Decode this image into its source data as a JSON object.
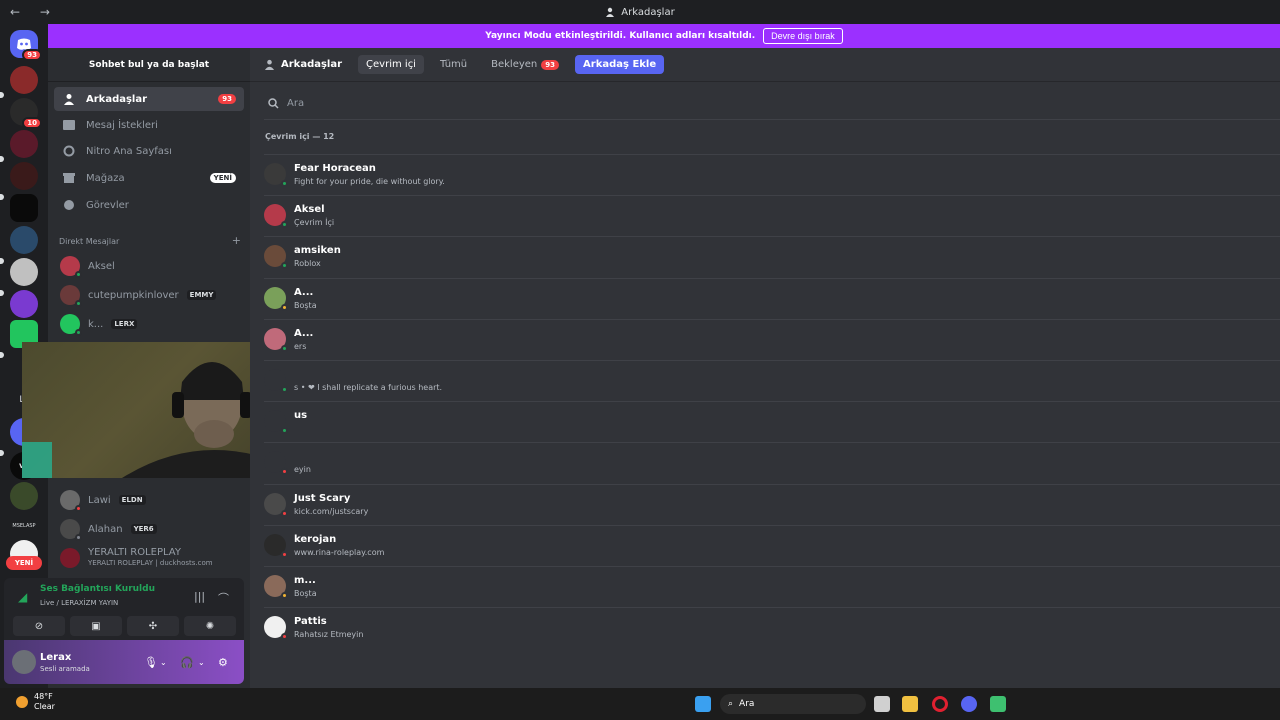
{
  "window": {
    "title": "Arkadaşlar",
    "nav_arrows": "← →"
  },
  "banner": {
    "text": "Yayıncı Modu etkinleştirildi. Kullanıcı adları kısaltıldı.",
    "button": "Devre dışı bırak"
  },
  "servers": {
    "home_badge": "93",
    "badge_2": "10",
    "new_label": "YENİ",
    "text_s1": "LY",
    "text_s2": "vc",
    "text_s3": "MSELASP"
  },
  "sidebar": {
    "search_label": "Sohbet bul ya da başlat",
    "nav": [
      {
        "label": "Arkadaşlar",
        "badge": "93"
      },
      {
        "label": "Mesaj İstekleri"
      },
      {
        "label": "Nitro Ana Sayfası"
      },
      {
        "label": "Mağaza",
        "badge": "YENİ"
      },
      {
        "label": "Görevler"
      }
    ],
    "dm_header": "Direkt Mesajlar",
    "dm_add": "+",
    "dms": [
      {
        "name": "Aksel"
      },
      {
        "name": "cutepumpkinlover",
        "tag": "EMMY"
      },
      {
        "name": "k...",
        "tag": "LERX"
      },
      {
        "name": "Lawi",
        "tag": "ELDN"
      },
      {
        "name": "Alahan",
        "tag": "YER6"
      },
      {
        "name": "YERALTI ROLEPLAY",
        "sub": "YERALTI ROLEPLAY | duckhosts.com"
      }
    ]
  },
  "voice": {
    "title": "Ses Bağlantısı Kuruldu",
    "subtitle": "Live / LERAXİZM YAYIN"
  },
  "user": {
    "name": "Lerax",
    "status": "Sesli aramada"
  },
  "toolbar": {
    "home_label": "Arkadaşlar",
    "tabs": [
      {
        "label": "Çevrim içi"
      },
      {
        "label": "Tümü"
      },
      {
        "label": "Bekleyen",
        "badge": "93"
      },
      {
        "label": "Arkadaş Ekle"
      }
    ]
  },
  "friends_search": {
    "placeholder": "Ara"
  },
  "online_header": "Çevrim içi — 12",
  "friends": [
    {
      "name": "Fear Horacean",
      "status": "Fight for your pride, die without glory.",
      "dot": "#23a55a",
      "avatar": "#3a3a3a"
    },
    {
      "name": "Aksel",
      "status": "Çevrim İçi",
      "dot": "#23a55a",
      "avatar": "#b53a4a"
    },
    {
      "name": "amsiken",
      "status": "Roblox",
      "dot": "#23a55a",
      "avatar": "#6a4b3a"
    },
    {
      "name": "A...",
      "status": "Boşta",
      "dot": "#f0b232",
      "avatar": "#7aa05a"
    },
    {
      "name": "A...",
      "status": "ers",
      "dot": "#23a55a",
      "avatar": "#c06a7a"
    },
    {
      "name": "",
      "status": "s • ❤ I shall replicate a furious heart.",
      "dot": "#23a55a",
      "avatar": "#313338"
    },
    {
      "name": "us",
      "status": "",
      "dot": "#23a55a",
      "avatar": "#313338"
    },
    {
      "name": "",
      "status": "eyin",
      "dot": "#f23f42",
      "avatar": "#313338"
    },
    {
      "name": "Just Scary",
      "status": "kick.com/justscary",
      "dot": "#f23f42",
      "avatar": "#4a4a4a"
    },
    {
      "name": "kerojan",
      "status": "www.rina-roleplay.com",
      "dot": "#f23f42",
      "avatar": "#2a2a2a"
    },
    {
      "name": "m...",
      "status": "Boşta",
      "dot": "#f0b232",
      "avatar": "#8a6a5a"
    },
    {
      "name": "Pattis",
      "status": "Rahatsız Etmeyin",
      "dot": "#f23f42",
      "avatar": "#f0f0f0"
    }
  ],
  "taskbar": {
    "temp": "48°F",
    "weather": "Clear",
    "search": "Ara"
  },
  "colors": {
    "accent": "#5865f2",
    "banner": "#9b30ff",
    "danger": "#f23f42",
    "online": "#23a55a"
  }
}
